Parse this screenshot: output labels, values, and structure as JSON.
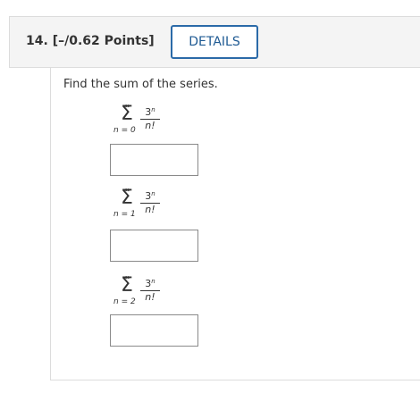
{
  "question": {
    "number": "14.",
    "points": "[–/0.62 Points]",
    "details_label": "DETAILS"
  },
  "prompt": "Find the sum of the series.",
  "series": [
    {
      "upper": "∞",
      "sigma": "Σ",
      "lower": "n = 0",
      "numerator_base": "3",
      "numerator_exp": "n",
      "denominator": "n!",
      "answer": ""
    },
    {
      "upper": "∞",
      "sigma": "Σ",
      "lower": "n = 1",
      "numerator_base": "3",
      "numerator_exp": "n",
      "denominator": "n!",
      "answer": ""
    },
    {
      "upper": "∞",
      "sigma": "Σ",
      "lower": "n = 2",
      "numerator_base": "3",
      "numerator_exp": "n",
      "denominator": "n!",
      "answer": ""
    }
  ]
}
